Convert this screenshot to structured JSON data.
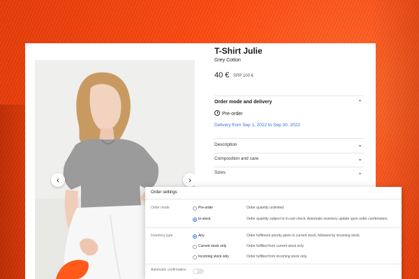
{
  "product": {
    "title": "T-Shirt Julie",
    "subtitle": "Grey Cotton",
    "price": "40 €",
    "srp": "SRP 100 €",
    "order_section": {
      "title": "Order mode and delivery",
      "mode": "Pre-order",
      "delivery": "Delivery from Sep 1, 2022 to Sep 30, 2022",
      "expanded": true
    },
    "accordions": [
      {
        "label": "Description"
      },
      {
        "label": "Composition and care"
      },
      {
        "label": "Sizes"
      }
    ],
    "gallery": {
      "prev_icon": "chevron-left-icon",
      "next_icon": "chevron-right-icon"
    }
  },
  "order_settings": {
    "title": "Order settings",
    "order_mode": {
      "label": "Order mode",
      "options": [
        {
          "label": "Pre-order",
          "checked": false,
          "desc": "Order quantity unlimited."
        },
        {
          "label": "In-stock",
          "checked": true,
          "desc": "Order quantity subject to in-cart check. Automatic inventory update upon order confirmation."
        }
      ]
    },
    "inventory_type": {
      "label": "Inventory type",
      "options": [
        {
          "label": "Any",
          "checked": true,
          "desc": "Order fulfilment priority given to current stock, followed by incoming stock."
        },
        {
          "label": "Current stock only",
          "checked": false,
          "desc": "Order fulfilled from current stock only."
        },
        {
          "label": "Incoming stock only",
          "checked": false,
          "desc": "Order fulfilled from incoming stock only."
        }
      ]
    },
    "auto_confirmation": {
      "label": "Automatic confirmation",
      "enabled": false
    }
  },
  "colors": {
    "accent": "#2f6fe3",
    "background": "#ff5218"
  }
}
